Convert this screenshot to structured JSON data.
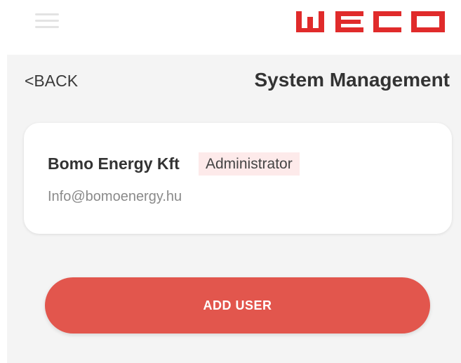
{
  "topbar": {
    "menu_icon": "hamburger-menu-icon",
    "logo_text": "WECO",
    "brand_color": "#e02b2b"
  },
  "header": {
    "back_label": "<BACK",
    "title": "System Management"
  },
  "user_card": {
    "name": "Bomo Energy Kft",
    "role": "Administrator",
    "email": "Info@bomoenergy.hu"
  },
  "actions": {
    "add_user_label": "ADD USER",
    "accent_color": "#e2564d"
  }
}
